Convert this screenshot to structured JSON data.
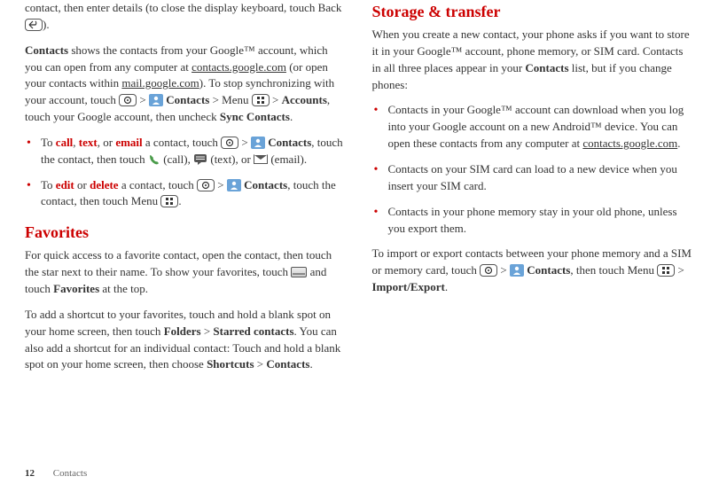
{
  "col1": {
    "para1": {
      "pre": "contact, then enter details (to close the display keyboard, touch Back ",
      "post": ")."
    },
    "para2": {
      "t1": "Contacts",
      "t2": " shows the contacts from your Google™ account, which you can open from any computer at ",
      "link1": "contacts.google.com",
      "t3": " (or open your contacts within ",
      "link2": "mail.google.com",
      "t4": "). To stop synchronizing with your account, touch ",
      "gt1": " > ",
      "contacts": " Contacts",
      "t5": " > Menu ",
      "gt2": " > ",
      "accounts": "Accounts",
      "t6": ", touch your Google account, then uncheck ",
      "sync": "Sync Contacts",
      "t7": "."
    },
    "bullet1": {
      "pre": "To ",
      "w1": "call",
      "c1": ", ",
      "w2": "text",
      "c2": ", or ",
      "w3": "email",
      "t1": " a contact, touch ",
      "gt": " > ",
      "contacts": " Contacts",
      "t2": ", touch the contact, then touch ",
      "call": " (call), ",
      "text": " (text), or ",
      "email": " (email)."
    },
    "bullet2": {
      "pre": "To ",
      "w1": "edit",
      "c1": " or ",
      "w2": "delete",
      "t1": " a contact, touch ",
      "gt": " > ",
      "contacts": " Contacts",
      "t2": ", touch the contact, then touch Menu ",
      "t3": "."
    },
    "favHeading": "Favorites",
    "favPara1": {
      "t1": "For quick access to a favorite contact, open the contact, then touch the star next to their name. To show your favorites, touch ",
      "t2": " and touch ",
      "fav": "Favorites",
      "t3": " at the top."
    },
    "favPara2": {
      "t1": "To add a shortcut to your favorites, touch and hold a blank spot on your home screen, then touch ",
      "folders": "Folders",
      "gt1": " > ",
      "starred": "Starred contacts",
      "t2": ". You can also add a shortcut for an individual contact: Touch and hold a blank spot on your home screen, then choose ",
      "shortcuts": "Shortcuts",
      "gt2": " > ",
      "contacts": "Contacts",
      "t3": "."
    }
  },
  "col2": {
    "heading": "Storage & transfer",
    "para1": {
      "t1": "When you create a new contact, your phone asks if you want to store it in your Google™ account, phone memory, or SIM card. Contacts in all three places appear in your ",
      "contacts": "Contacts",
      "t2": " list, but if you change phones:"
    },
    "b1": {
      "t1": "Contacts in your Google™ account can download when you log into your Google account on a new Android™ device. You can open these contacts from any computer at ",
      "link": "contacts.google.com",
      "t2": "."
    },
    "b2": "Contacts on your SIM card can load to a new device when you insert your SIM card.",
    "b3": "Contacts in your phone memory stay in your old phone, unless you export them.",
    "para2": {
      "t1": "To import or export contacts between your phone memory and a SIM or memory card, touch ",
      "gt1": " > ",
      "contacts": " Contacts",
      "t2": ", then touch Menu ",
      "gt2": " > ",
      "import": "Import/Export",
      "t3": "."
    }
  },
  "footer": {
    "page": "12",
    "section": "Contacts"
  }
}
